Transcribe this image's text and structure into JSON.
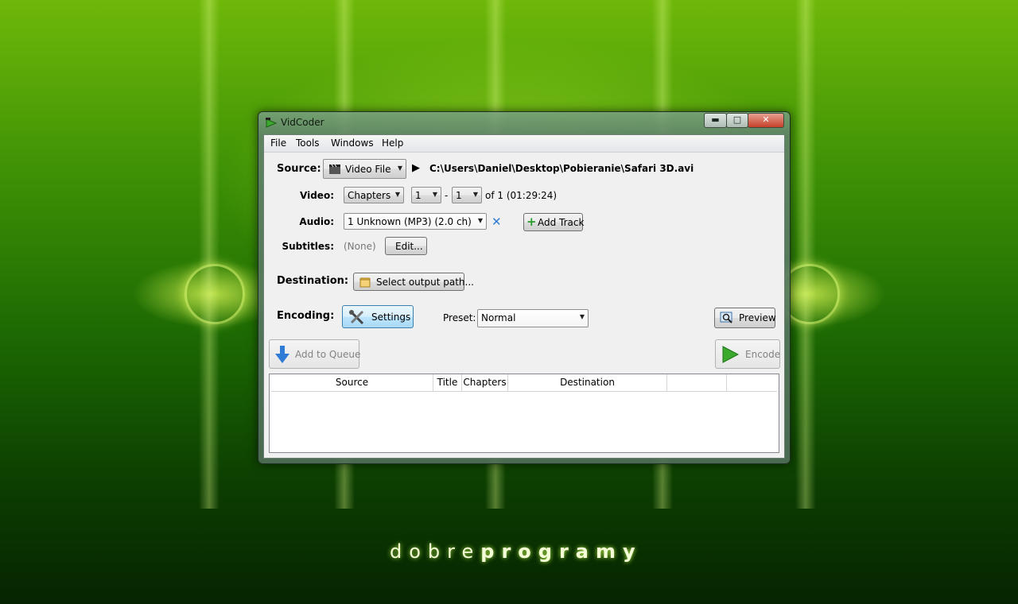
{
  "window": {
    "title": "VidCoder",
    "min_label": "▬",
    "max_label": "□",
    "close_label": "✕"
  },
  "menu": [
    "File",
    "Tools",
    "Windows",
    "Help"
  ],
  "source": {
    "label": "Source:",
    "type_value": "Video File",
    "path": "C:\\Users\\Daniel\\Desktop\\Pobieranie\\Safari 3D.avi"
  },
  "video": {
    "label": "Video:",
    "range_type": "Chapters",
    "start": "1",
    "separator": "-",
    "end": "1",
    "of_text": "of 1 (01:29:24)"
  },
  "audio": {
    "label": "Audio:",
    "track_value": "1 Unknown (MP3) (2.0 ch)",
    "add_track_label": "Add Track"
  },
  "subtitles": {
    "label": "Subtitles:",
    "value": "(None)",
    "edit_label": "Edit..."
  },
  "destination": {
    "label": "Destination:",
    "button_label": "Select output path..."
  },
  "encoding": {
    "label": "Encoding:",
    "settings_label": "Settings",
    "preset_label": "Preset:",
    "preset_value": "Normal",
    "preview_label": "Preview"
  },
  "actions": {
    "add_to_queue_label": "Add to Queue",
    "encode_label": "Encode"
  },
  "queue": {
    "columns": [
      "Source",
      "Title",
      "Chapters",
      "Destination",
      "",
      ""
    ],
    "rows": []
  },
  "background": {
    "brand_light": "dobre",
    "brand_bold": "programy"
  },
  "colors": {
    "accent_blue": "#2e7cd6",
    "green_play": "#3aa92e"
  },
  "icons": {
    "app": "vidcoder-clapper-icon",
    "video_file": "film-clapper-icon",
    "play": "play-arrow-icon",
    "remove": "x-remove-icon",
    "add": "plus-icon",
    "folder": "folder-icon",
    "settings": "tools-icon",
    "preview": "magnifier-preview-icon",
    "queue": "down-arrow-icon",
    "encode": "play-icon"
  }
}
